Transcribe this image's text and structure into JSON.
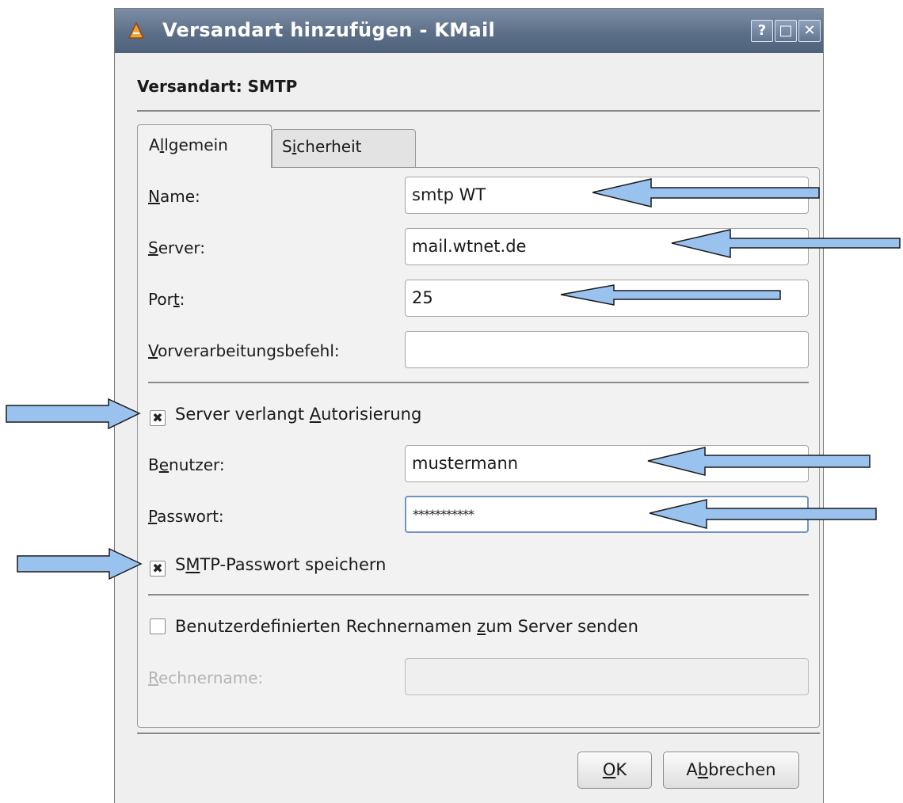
{
  "window": {
    "title": "Versandart hinzufügen - KMail",
    "help_btn": "?",
    "max_btn": "□",
    "close_btn": "✕"
  },
  "heading": "Versandart: SMTP",
  "tabs": [
    {
      "pre": "A",
      "u": "l",
      "post": "lgemein"
    },
    {
      "pre": "S",
      "u": "i",
      "post": "cherheit"
    }
  ],
  "form": {
    "name": {
      "u": "N",
      "rest": "ame:",
      "value": "smtp WT"
    },
    "server": {
      "u": "S",
      "rest": "erver:",
      "value": "mail.wtnet.de"
    },
    "port": {
      "pre": "Por",
      "u": "t",
      "post": ":",
      "value": "25"
    },
    "vorverarbeitung": {
      "u": "V",
      "rest": "orverarbeitungsbefehl:",
      "value": ""
    },
    "auth": {
      "checked": "✖",
      "pre": "Server verlangt ",
      "u": "A",
      "post": "utorisierung"
    },
    "benutzer": {
      "pre": "B",
      "u": "e",
      "post": "nutzer:",
      "value": "mustermann"
    },
    "passwort": {
      "u": "P",
      "rest": "asswort:",
      "value": "***********"
    },
    "store_pw": {
      "checked": "✖",
      "pre": "S",
      "u": "M",
      "post": "TP-Passwort speichern"
    },
    "custom_host": {
      "checked": "",
      "pre": "Benutzerdefinierten Rechnernamen ",
      "u": "z",
      "post": "um Server senden"
    },
    "rechnername": {
      "u": "R",
      "rest": "echnername:",
      "value": ""
    }
  },
  "buttons": {
    "ok": {
      "u": "O",
      "rest": "K"
    },
    "cancel": {
      "pre": "A",
      "u": "b",
      "post": "brechen"
    }
  },
  "colors": {
    "arrow_fill": "#99c3ee",
    "arrow_stroke": "#1a1a1a",
    "titlebar": "#5c6f88"
  }
}
